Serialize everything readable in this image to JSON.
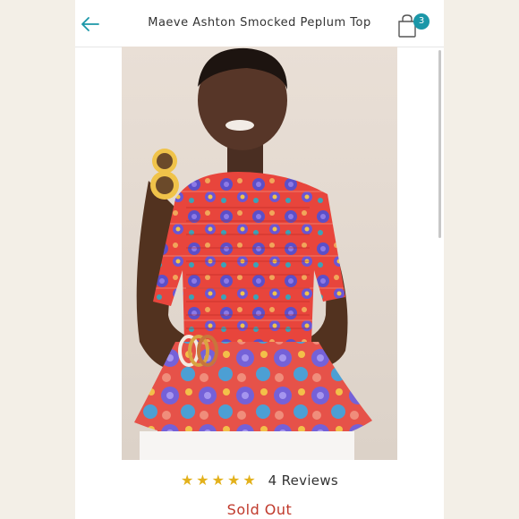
{
  "header": {
    "back_icon": "arrow-left-icon",
    "title": "Maeve Ashton Smocked Peplum Top",
    "cart_icon": "shopping-bag-icon",
    "cart_count": "3",
    "accent": "#1b97a8"
  },
  "product": {
    "image_alt": "Model wearing red floral smocked peplum top holding yellow sunglasses",
    "rating": 5,
    "stars": [
      "★",
      "★",
      "★",
      "★",
      "★"
    ],
    "star_color": "#e3b11b",
    "reviews_label": "4 Reviews",
    "status": "Sold Out",
    "status_color": "#c0392b"
  }
}
